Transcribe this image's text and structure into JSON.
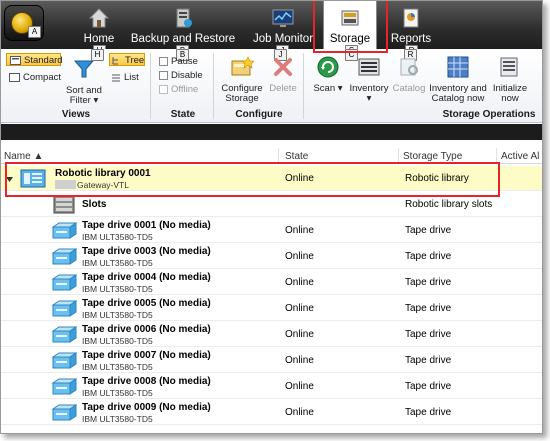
{
  "tabs": [
    {
      "label": "Home",
      "key": "H",
      "icon": "home-icon"
    },
    {
      "label": "Backup and Restore",
      "key": "B",
      "icon": "backup-restore-icon"
    },
    {
      "label": "Job Monitor",
      "key": "J",
      "icon": "job-monitor-icon"
    },
    {
      "label": "Storage",
      "key": "S",
      "icon": "storage-icon",
      "active": true
    },
    {
      "label": "Reports",
      "key": "R",
      "icon": "reports-icon"
    }
  ],
  "app_key": "A",
  "ribbon": {
    "views": {
      "label": "Views",
      "standard": "Standard",
      "compact": "Compact",
      "sort_filter": [
        "Sort and",
        "Filter ▾"
      ],
      "tree": "Tree",
      "list": "List"
    },
    "state": {
      "label": "State",
      "pause": "Pause",
      "disable": "Disable",
      "offline": "Offline"
    },
    "configure": {
      "label": "Configure",
      "configure_storage": [
        "Configure",
        "Storage"
      ],
      "delete": "Delete"
    },
    "operations": {
      "label": "Storage Operations",
      "scan": "Scan ▾",
      "inventory": "Inventory ▾",
      "catalog": "Catalog",
      "inventory_catalog": [
        "Inventory and",
        "Catalog now"
      ],
      "initialize": [
        "Initialize",
        "now"
      ]
    }
  },
  "columns": {
    "name": "Name ▲",
    "state": "State",
    "storage_type": "Storage Type",
    "active_alerts": "Active Al"
  },
  "library": {
    "name": "Robotic library 0001",
    "sub": "Gateway-VTL",
    "state": "Online",
    "type": "Robotic library"
  },
  "slots": {
    "name": "Slots",
    "type": "Robotic library slots"
  },
  "drives": [
    {
      "name": "Tape drive 0001 (No media)",
      "model": "IBM ULT3580-TD5",
      "state": "Online",
      "type": "Tape drive"
    },
    {
      "name": "Tape drive 0003 (No media)",
      "model": "IBM ULT3580-TD5",
      "state": "Online",
      "type": "Tape drive"
    },
    {
      "name": "Tape drive 0004 (No media)",
      "model": "IBM ULT3580-TD5",
      "state": "Online",
      "type": "Tape drive"
    },
    {
      "name": "Tape drive 0005 (No media)",
      "model": "IBM ULT3580-TD5",
      "state": "Online",
      "type": "Tape drive"
    },
    {
      "name": "Tape drive 0006 (No media)",
      "model": "IBM ULT3580-TD5",
      "state": "Online",
      "type": "Tape drive"
    },
    {
      "name": "Tape drive 0007 (No media)",
      "model": "IBM ULT3580-TD5",
      "state": "Online",
      "type": "Tape drive"
    },
    {
      "name": "Tape drive 0008 (No media)",
      "model": "IBM ULT3580-TD5",
      "state": "Online",
      "type": "Tape drive"
    },
    {
      "name": "Tape drive 0009 (No media)",
      "model": "IBM ULT3580-TD5",
      "state": "Online",
      "type": "Tape drive"
    }
  ],
  "colors": {
    "highlight": "#e8232a",
    "selected_row": "#fdfbc6"
  }
}
